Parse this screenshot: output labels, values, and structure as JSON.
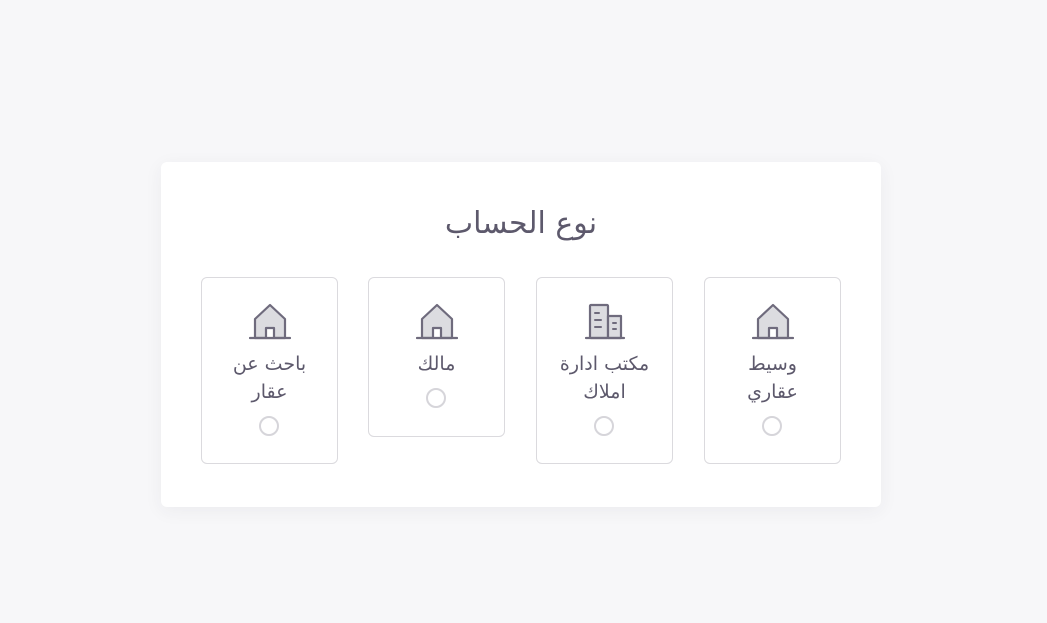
{
  "title": "نوع الحساب",
  "options": [
    {
      "label": "وسيط\nعقاري",
      "icon": "house-icon",
      "selected": false
    },
    {
      "label": "مكتب ادارة\nاملاك",
      "icon": "building-icon",
      "selected": false
    },
    {
      "label": "مالك",
      "icon": "house-icon",
      "selected": false
    },
    {
      "label": "باحث عن\nعقار",
      "icon": "house-icon",
      "selected": false
    }
  ],
  "colors": {
    "background": "#f7f7f9",
    "card": "#ffffff",
    "text": "#5d596c",
    "border": "#dbdade",
    "icon_fill": "#dcdce0",
    "icon_stroke": "#6f6b7d"
  }
}
